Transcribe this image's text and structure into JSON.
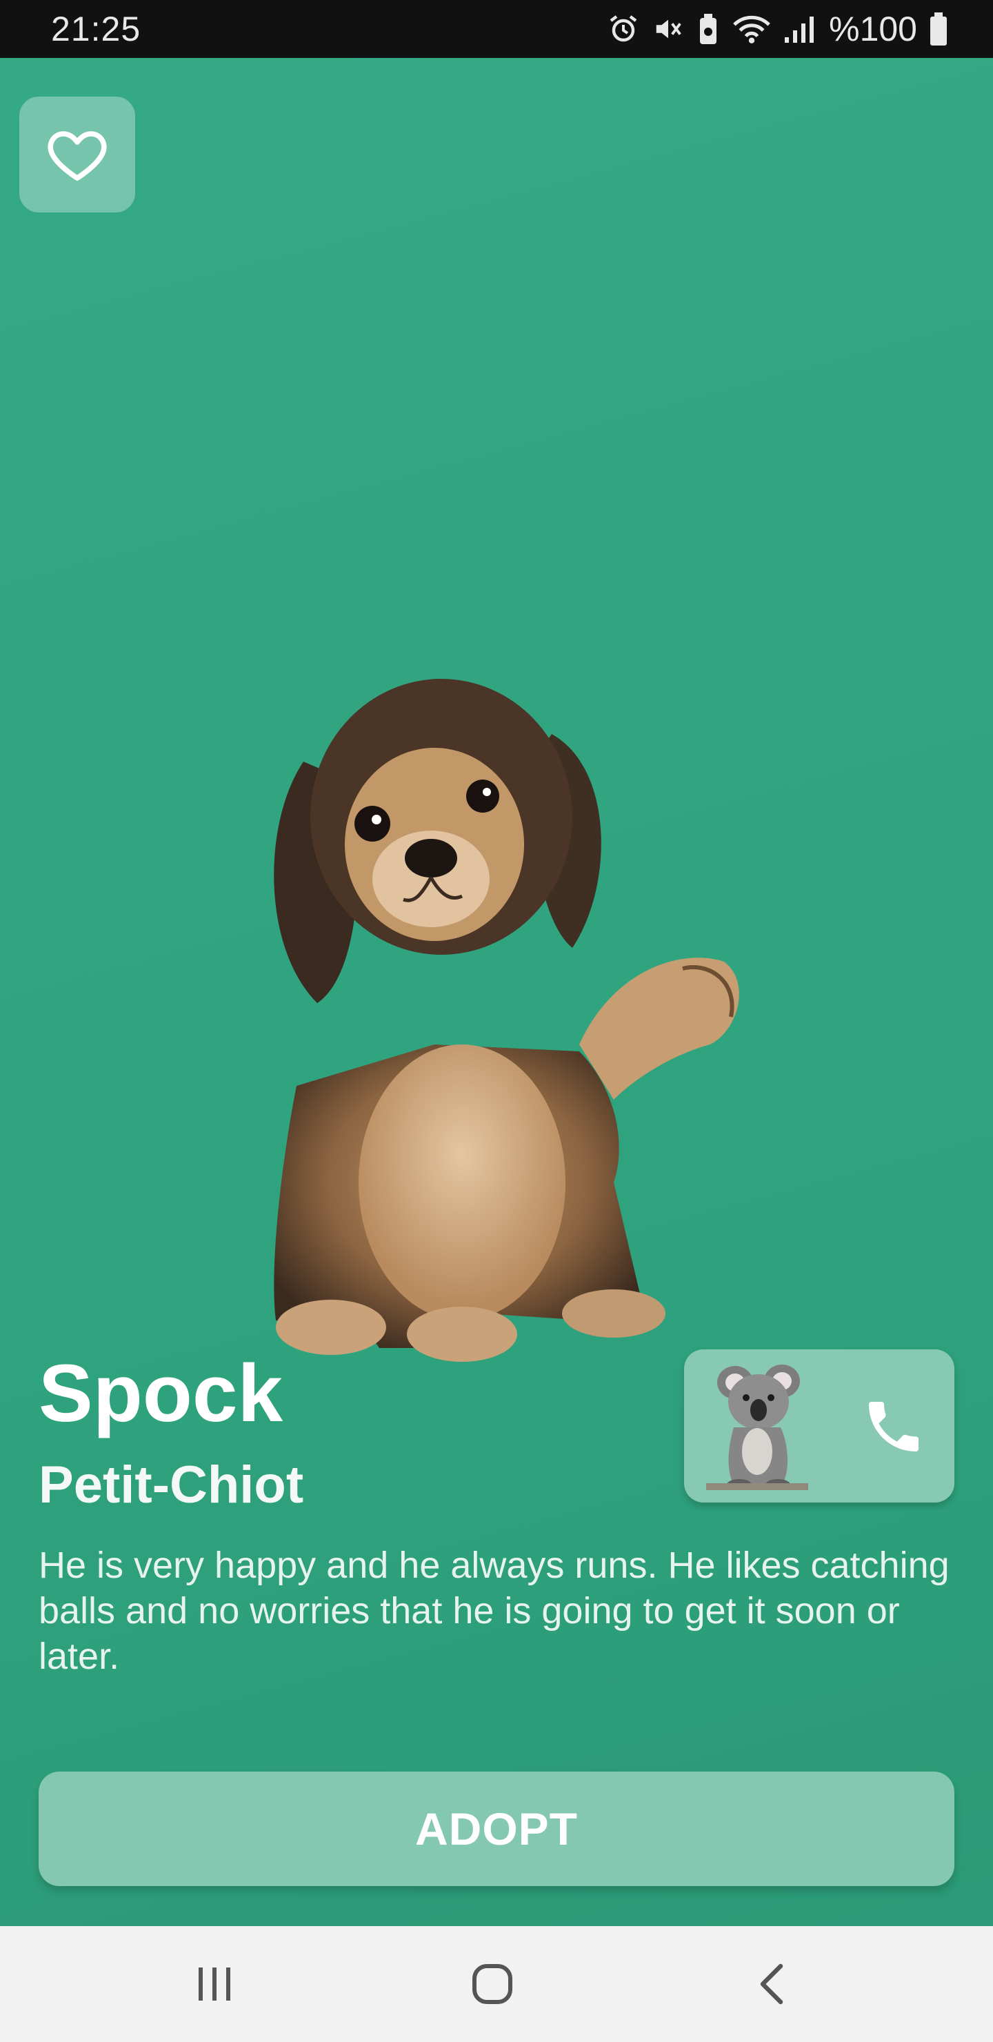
{
  "status_bar": {
    "time": "21:25",
    "battery_text": "%100",
    "icons": [
      "alarm-icon",
      "mute-icon",
      "battery-saver-icon",
      "wifi-icon",
      "signal-icon",
      "battery-icon"
    ]
  },
  "favorite": {
    "icon": "heart-outline-icon"
  },
  "pet": {
    "name": "Spock",
    "breed": "Petit-Chiot",
    "description": "He is very happy and he always runs. He likes catching balls and no worries that he is going to get it soon or later.",
    "image": "puppy-photo"
  },
  "contact": {
    "owner_image": "koala-photo",
    "call_icon": "phone-icon"
  },
  "actions": {
    "adopt_label": "ADOPT"
  },
  "nav_bar": {
    "items": [
      "recent-apps-icon",
      "home-icon",
      "back-icon"
    ]
  },
  "colors": {
    "background": "#33a682",
    "card": "#88c9b3",
    "text": "#ffffff"
  }
}
